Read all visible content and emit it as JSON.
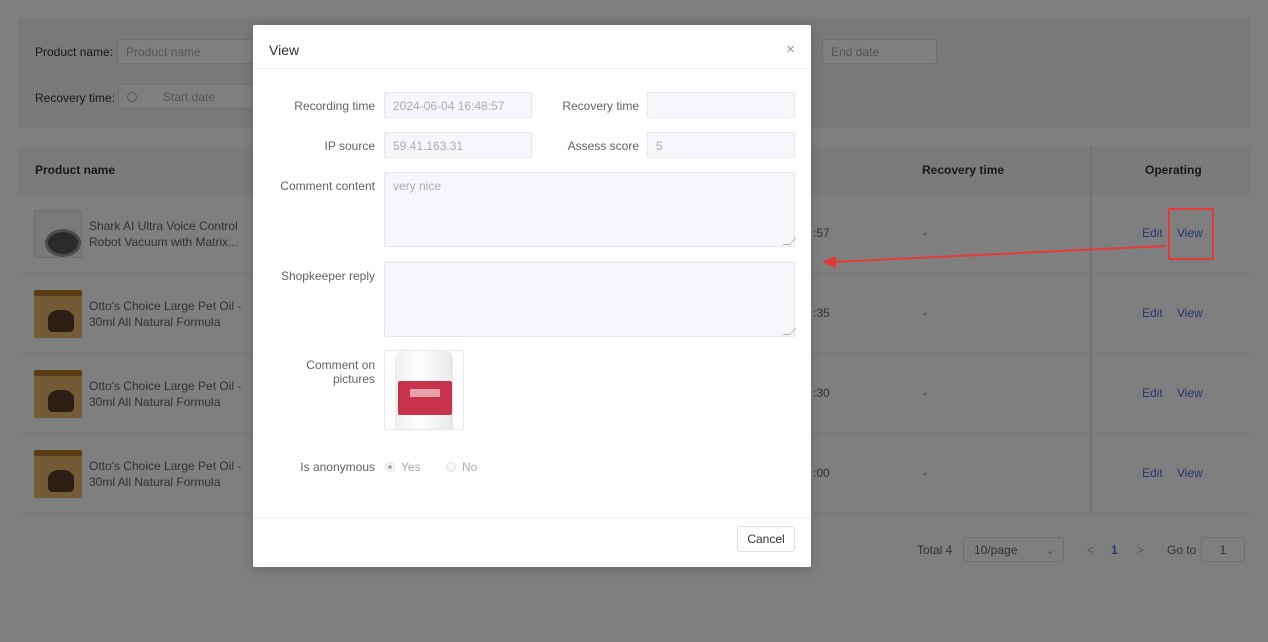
{
  "filters": {
    "product_name_label": "Product name:",
    "product_name_placeholder": "Product name",
    "end_date_placeholder": "End date",
    "recovery_time_label": "Recovery time:",
    "start_date_placeholder": "Start date"
  },
  "table": {
    "headers": {
      "product_name": "Product name",
      "recovery_time": "Recovery time",
      "operating": "Operating"
    },
    "rows": [
      {
        "name": "Shark AI Ultra Voice Control Robot Vacuum with Matrix...",
        "time_fragment": ":57",
        "recovery": "-",
        "edit": "Edit",
        "view": "View"
      },
      {
        "name": "Otto's Choice Large Pet Oil - 30ml All Natural Formula",
        "time_fragment": ":35",
        "recovery": "-",
        "edit": "Edit",
        "view": "View"
      },
      {
        "name": "Otto's Choice Large Pet Oil - 30ml All Natural Formula",
        "time_fragment": ":30",
        "recovery": "-",
        "edit": "Edit",
        "view": "View"
      },
      {
        "name": "Otto's Choice Large Pet Oil - 30ml All Natural Formula",
        "time_fragment": ":00",
        "recovery": "-",
        "edit": "Edit",
        "view": "View"
      }
    ]
  },
  "pagination": {
    "total": "Total 4",
    "page_size": "10/page",
    "prev": "<",
    "current_page": "1",
    "next": ">",
    "goto_label": "Go to",
    "goto_value": "1"
  },
  "dialog": {
    "title": "View",
    "close": "×",
    "recording_time_label": "Recording time",
    "recording_time_value": "2024-06-04 16:48:57",
    "recovery_time_label": "Recovery time",
    "recovery_time_value": "",
    "ip_source_label": "IP source",
    "ip_source_value": "59.41.163.31",
    "assess_score_label": "Assess score",
    "assess_score_value": "5",
    "comment_content_label": "Comment content",
    "comment_content_value": "very nice",
    "shopkeeper_reply_label": "Shopkeeper reply",
    "shopkeeper_reply_value": "",
    "comment_pictures_label": "Comment on pictures",
    "anonymous_label": "Is anonymous",
    "anonymous_yes": "Yes",
    "anonymous_no": "No",
    "anonymous_selected": "Yes",
    "cancel_label": "Cancel"
  },
  "colors": {
    "link": "#4a6fd8",
    "annotation": "#e53935",
    "mask": "rgba(0,0,0,0.5)"
  }
}
